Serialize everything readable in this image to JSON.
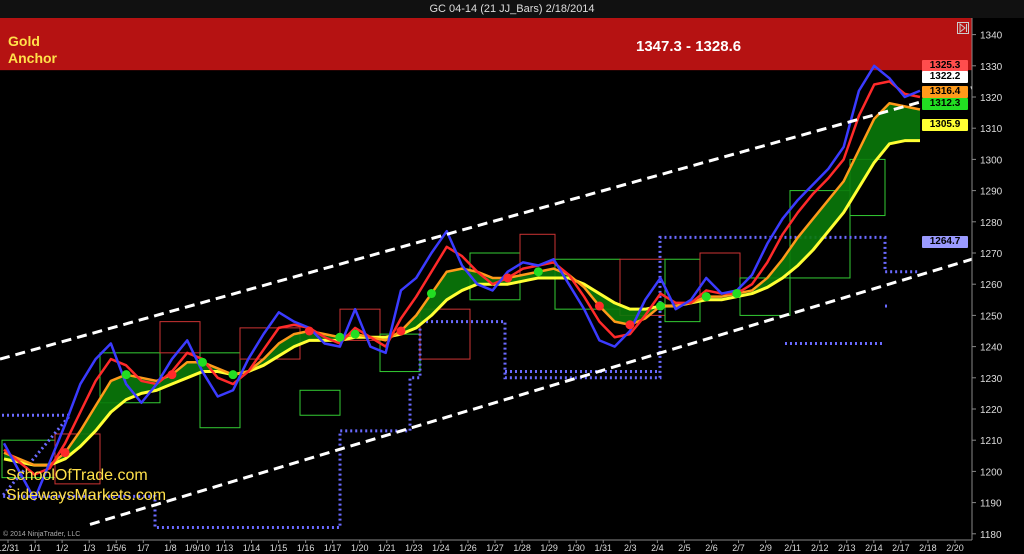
{
  "title": "GC 04-14 (21 JJ_Bars)  2/18/2014",
  "gold_label_1": "Gold",
  "gold_label_2": "Anchor",
  "resistance_text": "1347.3 - 1328.6",
  "watermark_1": "SchoolOfTrade.com",
  "watermark_2": "SidewaysMarkets.com",
  "copyright": "© 2014 NinjaTrader, LLC",
  "colors": {
    "background": "#000000",
    "resistance_zone": "#b51212",
    "price_line": "#3b3bff",
    "fast_ema": "#ff2a2a",
    "mid_ema": "#ff9a1a",
    "slow_ema": "#ffff33",
    "cloud": "#0a7a0a",
    "channel": "#ffffff",
    "dotted_level": "#6a6aff"
  },
  "price_tags": [
    {
      "value": "1325.3",
      "color": "#ff4d4d"
    },
    {
      "value": "1322.2",
      "color": "#ffffff"
    },
    {
      "value": "1316.4",
      "color": "#ff9a1a"
    },
    {
      "value": "1312.3",
      "color": "#22dd22"
    },
    {
      "value": "1305.9",
      "color": "#ffff33"
    },
    {
      "value": "1264.7",
      "color": "#9a9aff"
    }
  ],
  "chart_data": {
    "type": "line",
    "title": "GC 04-14 (21 JJ_Bars)  2/18/2014",
    "ylim": [
      1175,
      1345
    ],
    "y_ticks": [
      1180,
      1190,
      1200,
      1210,
      1220,
      1230,
      1240,
      1250,
      1260,
      1270,
      1280,
      1290,
      1300,
      1310,
      1320,
      1330,
      1340
    ],
    "x_tick_labels": [
      "12/31",
      "1/1",
      "1/2",
      "1/3",
      "1/5/6",
      "1/7",
      "1/8",
      "1/9/10",
      "1/13",
      "1/14",
      "1/15",
      "1/16",
      "1/17",
      "1/20",
      "1/21",
      "1/23",
      "1/24",
      "1/26",
      "1/27",
      "1/28",
      "1/29",
      "1/30",
      "1/31",
      "2/3",
      "2/4",
      "2/5",
      "2/6",
      "2/7",
      "2/9",
      "2/11",
      "2/12",
      "2/13",
      "2/14",
      "2/17",
      "2/18",
      "2/20"
    ],
    "resistance_zone": [
      1328.6,
      1347.3
    ],
    "series": [
      {
        "values": [
          1209,
          1200,
          1191,
          1203,
          1215,
          1228,
          1236,
          1241,
          1228,
          1222,
          1228,
          1236,
          1242,
          1232,
          1224,
          1226,
          1236,
          1244,
          1251,
          1248,
          1246,
          1241,
          1240,
          1252,
          1240,
          1238,
          1258,
          1262,
          1270,
          1277,
          1266,
          1260,
          1258,
          1264,
          1267,
          1266,
          1268,
          1260,
          1252,
          1242,
          1240,
          1245,
          1255,
          1262,
          1252,
          1255,
          1262,
          1257,
          1258,
          1263,
          1273,
          1281,
          1287,
          1292,
          1297,
          1304,
          1322,
          1330,
          1326,
          1320,
          1322
        ]
      },
      {
        "values": [
          1207,
          1203,
          1199,
          1201,
          1209,
          1219,
          1229,
          1236,
          1234,
          1229,
          1228,
          1232,
          1238,
          1236,
          1230,
          1228,
          1232,
          1239,
          1246,
          1247,
          1246,
          1243,
          1241,
          1246,
          1243,
          1240,
          1249,
          1256,
          1264,
          1272,
          1269,
          1264,
          1260,
          1262,
          1265,
          1266,
          1267,
          1263,
          1256,
          1248,
          1243,
          1244,
          1250,
          1257,
          1254,
          1254,
          1258,
          1257,
          1257,
          1260,
          1267,
          1276,
          1283,
          1289,
          1294,
          1300,
          1314,
          1324,
          1325,
          1321,
          1320
        ]
      },
      {
        "values": [
          1206,
          1204,
          1202,
          1202,
          1206,
          1213,
          1221,
          1229,
          1231,
          1230,
          1229,
          1231,
          1235,
          1235,
          1233,
          1231,
          1232,
          1236,
          1241,
          1244,
          1245,
          1244,
          1243,
          1244,
          1243,
          1242,
          1245,
          1250,
          1257,
          1264,
          1265,
          1264,
          1262,
          1262,
          1263,
          1264,
          1265,
          1263,
          1259,
          1253,
          1248,
          1247,
          1249,
          1253,
          1253,
          1254,
          1256,
          1256,
          1257,
          1258,
          1262,
          1268,
          1275,
          1281,
          1287,
          1293,
          1303,
          1313,
          1318,
          1317,
          1316
        ]
      },
      {
        "values": [
          1204,
          1203,
          1202,
          1202,
          1204,
          1208,
          1213,
          1219,
          1223,
          1225,
          1226,
          1228,
          1230,
          1232,
          1232,
          1231,
          1232,
          1234,
          1237,
          1240,
          1242,
          1242,
          1242,
          1243,
          1243,
          1243,
          1244,
          1246,
          1250,
          1255,
          1258,
          1260,
          1260,
          1260,
          1261,
          1262,
          1262,
          1262,
          1260,
          1257,
          1254,
          1252,
          1252,
          1253,
          1253,
          1254,
          1255,
          1255,
          1256,
          1257,
          1259,
          1262,
          1266,
          1271,
          1277,
          1283,
          1291,
          1299,
          1305,
          1306,
          1306
        ]
      }
    ]
  }
}
